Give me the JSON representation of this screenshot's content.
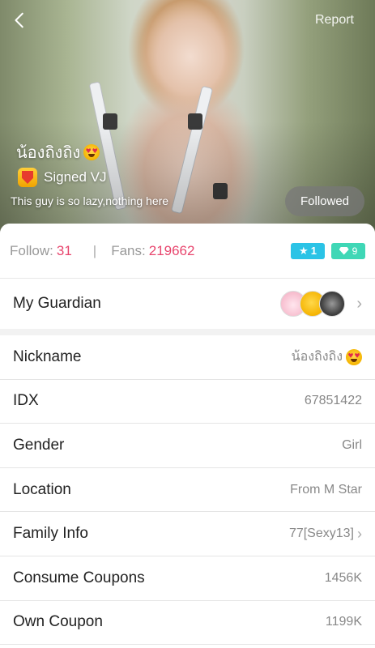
{
  "header": {
    "back_icon": "chevron-left-icon",
    "report_label": "Report"
  },
  "profile": {
    "name": "น้องถิงถิง",
    "name_emoji": "heart-eyes-emoji",
    "badge_icon": "signed-vj-shield-icon",
    "signed_label": "Signed VJ",
    "bio": "This guy is so lazy,nothing here",
    "followed_label": "Followed"
  },
  "stats": {
    "follow_label": "Follow:",
    "follow_value": "31",
    "separator": "|",
    "fans_label": "Fans:",
    "fans_value": "219662",
    "star_level": "1",
    "diamond_level": "9"
  },
  "guardian": {
    "label": "My Guardian",
    "avatars": [
      "cat-avatar",
      "emoji-avatar",
      "dark-avatar"
    ]
  },
  "info": [
    {
      "label": "Nickname",
      "value": "น้องถิงถิง",
      "has_emoji": true
    },
    {
      "label": "IDX",
      "value": "67851422"
    },
    {
      "label": "Gender",
      "value": "Girl"
    },
    {
      "label": "Location",
      "value": "From M Star"
    },
    {
      "label": "Family Info",
      "value": "77[Sexy13]",
      "has_chevron": true
    },
    {
      "label": "Consume Coupons",
      "value": "1456K"
    },
    {
      "label": "Own Coupon",
      "value": "1199K"
    }
  ],
  "colors": {
    "accent_pink": "#e8466e",
    "star_badge": "#2bc3e6",
    "diamond_badge": "#3fd7b6"
  }
}
